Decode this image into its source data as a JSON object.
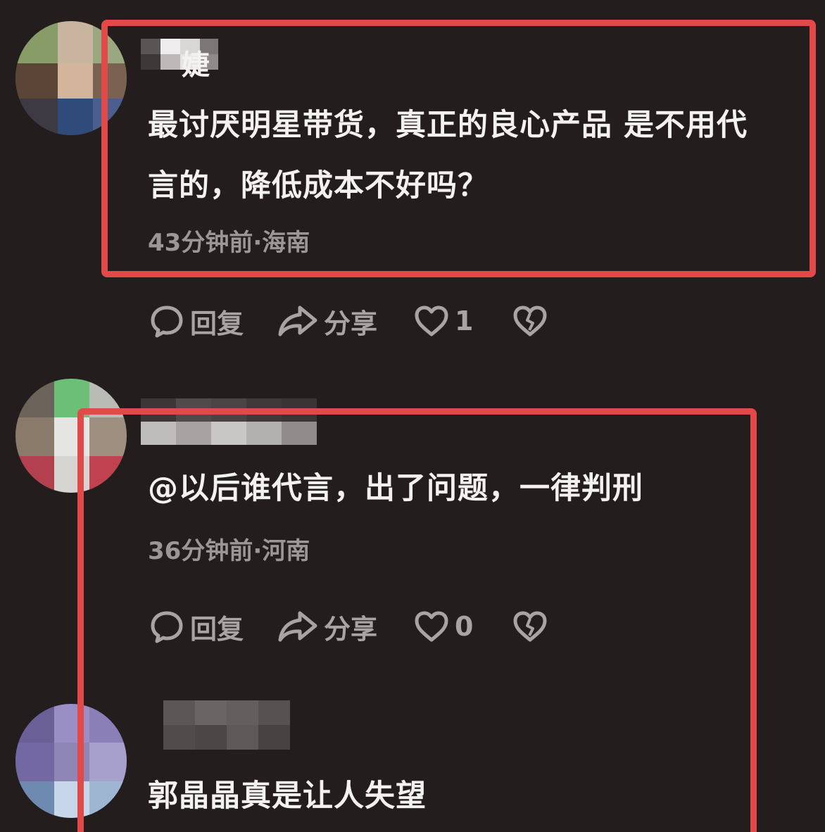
{
  "colors": {
    "background": "#231d1d",
    "highlight_border": "#e24a4a",
    "text": "#f4f1f1",
    "meta_text": "#9c9797"
  },
  "comments": [
    {
      "username_visible": "婕",
      "text_lines": [
        "最讨厌明星带货，真正的良心产品 是不用代",
        "言的，降低成本不好吗？"
      ],
      "meta": "43分钟前·海南",
      "actions": {
        "reply_label": "回复",
        "share_label": "分享",
        "like_count": "1"
      }
    },
    {
      "text_lines": [
        "@以后谁代言，出了问题，一律判刑"
      ],
      "meta": "36分钟前·河南",
      "actions": {
        "reply_label": "回复",
        "share_label": "分享",
        "like_count": "0"
      }
    },
    {
      "text_lines": [
        "郭晶晶真是让人失望"
      ]
    }
  ],
  "icons": [
    "reply-bubble-icon",
    "share-arrow-icon",
    "heart-icon",
    "broken-heart-icon"
  ]
}
